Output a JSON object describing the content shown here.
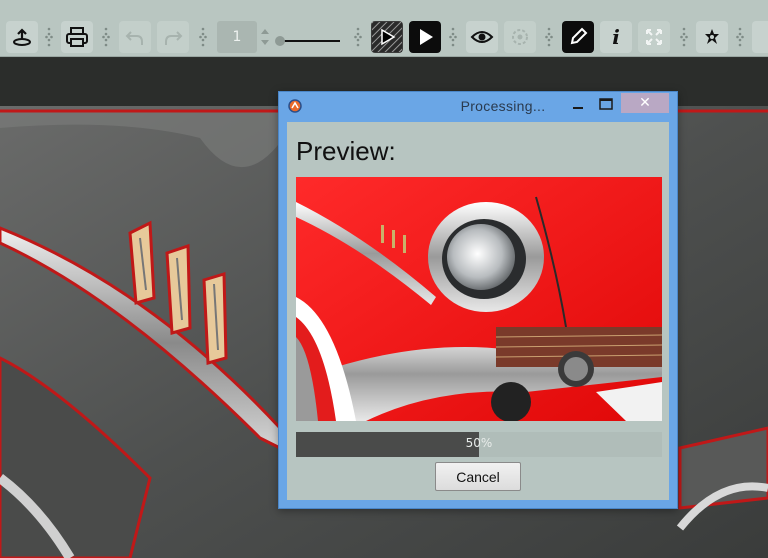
{
  "toolbar": {
    "page_number": "1",
    "buttons": [
      {
        "name": "upload-icon"
      },
      {
        "name": "print-icon"
      },
      {
        "name": "undo-icon"
      },
      {
        "name": "redo-icon"
      },
      {
        "name": "play-frame-icon"
      },
      {
        "name": "play-icon"
      },
      {
        "name": "eye-icon"
      },
      {
        "name": "target-icon"
      },
      {
        "name": "pencil-icon"
      },
      {
        "name": "info-icon"
      },
      {
        "name": "fullscreen-icon"
      },
      {
        "name": "star-settings-icon"
      }
    ]
  },
  "dialog": {
    "title": "Processing...",
    "preview_label": "Preview:",
    "progress_percent": 50,
    "progress_text": "50%",
    "cancel_label": "Cancel",
    "close_glyph": "✕"
  },
  "colors": {
    "toolbar_bg": "#b9c6c1",
    "dialog_frame": "#6aa6e6",
    "dialog_client": "#b7c5c1",
    "car_red": "#ff1a1a",
    "progress_fill": "#4a4b4a"
  }
}
